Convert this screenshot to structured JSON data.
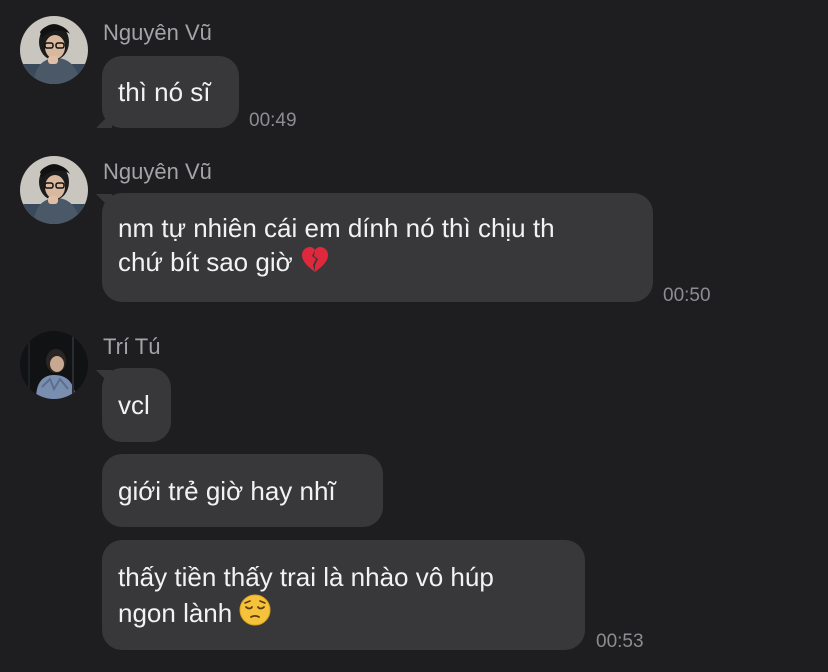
{
  "groups": [
    {
      "sender": "Nguyên Vũ",
      "messages": [
        {
          "text": "thì nó sĩ",
          "emoji": ""
        }
      ],
      "time": "00:49"
    },
    {
      "sender": "Nguyên Vũ",
      "messages": [
        {
          "line1": "nm tự nhiên cái em dính nó thì chịu th",
          "line2": "chứ bít sao giờ",
          "emoji": "broken-heart-icon"
        }
      ],
      "time": "00:50"
    },
    {
      "sender": "Trí Tú",
      "messages": [
        {
          "text": "vcl"
        },
        {
          "text": "giới trẻ giờ hay nhĩ"
        },
        {
          "line1": "thấy tiền thấy trai là nhào vô húp",
          "line2": "ngon lành",
          "emoji": "pensive-face-icon"
        }
      ],
      "time": "00:53"
    }
  ],
  "colors": {
    "background": "#1e1e20",
    "bubble": "#38383b",
    "sender": "#a4a4a8",
    "time": "#8d8d91",
    "text": "#f2f2f2"
  }
}
